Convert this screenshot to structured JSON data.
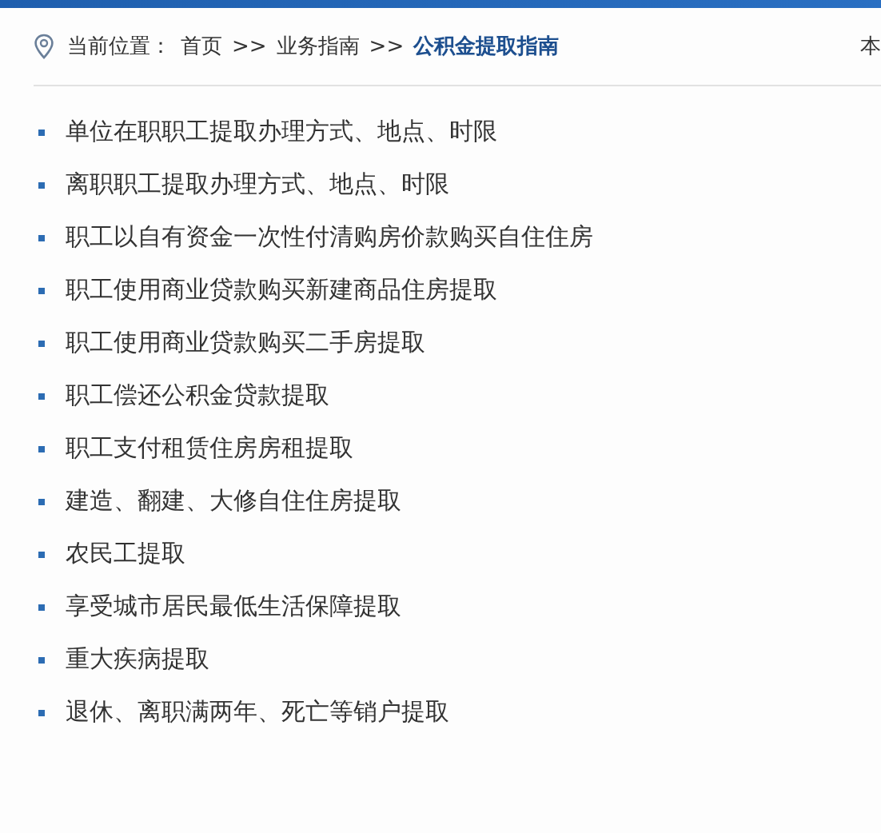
{
  "breadcrumb": {
    "label": "当前位置：",
    "items": [
      {
        "text": "首页",
        "current": false
      },
      {
        "text": "业务指南",
        "current": false
      },
      {
        "text": "公积金提取指南",
        "current": true
      }
    ],
    "separator": ">>"
  },
  "side_heading": "本",
  "guide_links": [
    "单位在职职工提取办理方式、地点、时限",
    "离职职工提取办理方式、地点、时限",
    "职工以自有资金一次性付清购房价款购买自住住房",
    "职工使用商业贷款购买新建商品住房提取",
    "职工使用商业贷款购买二手房提取",
    "职工偿还公积金贷款提取",
    "职工支付租赁住房房租提取",
    "建造、翻建、大修自住住房提取",
    "农民工提取",
    "享受城市居民最低生活保障提取",
    "重大疾病提取",
    "退休、离职满两年、死亡等销户提取"
  ]
}
